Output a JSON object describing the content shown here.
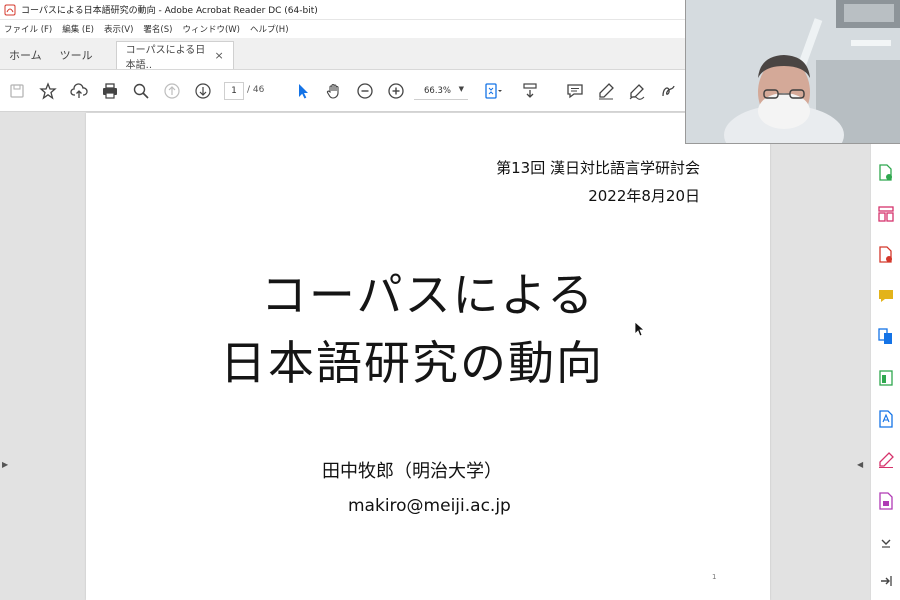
{
  "window": {
    "title": "コーパスによる日本語研究の動向 - Adobe Acrobat Reader DC (64-bit)"
  },
  "menu": [
    "ファイル (F)",
    "編集 (E)",
    "表示(V)",
    "署名(S)",
    "ウィンドウ(W)",
    "ヘルプ(H)"
  ],
  "tabs": {
    "home": "ホーム",
    "tools": "ツール",
    "document": "コーパスによる日本語..",
    "close": "×"
  },
  "toolbar": {
    "page_current": "1",
    "page_total": "/ 46",
    "zoom": "66.3%"
  },
  "slide": {
    "conference": "第13回 漢日対比語言学研討会",
    "date": "2022年8月20日",
    "title_line1": "コーパスによる",
    "title_line2": "日本語研究の動向",
    "author": "田中牧郎（明治大学）",
    "email": "makiro@meiji.ac.jp",
    "page_number": "1"
  },
  "colors": {
    "accent": "#1473e6",
    "acrobat_red": "#d4372b",
    "panel_pink": "#d6336c",
    "panel_green": "#2fa84f",
    "panel_yellow": "#e3b31a"
  }
}
